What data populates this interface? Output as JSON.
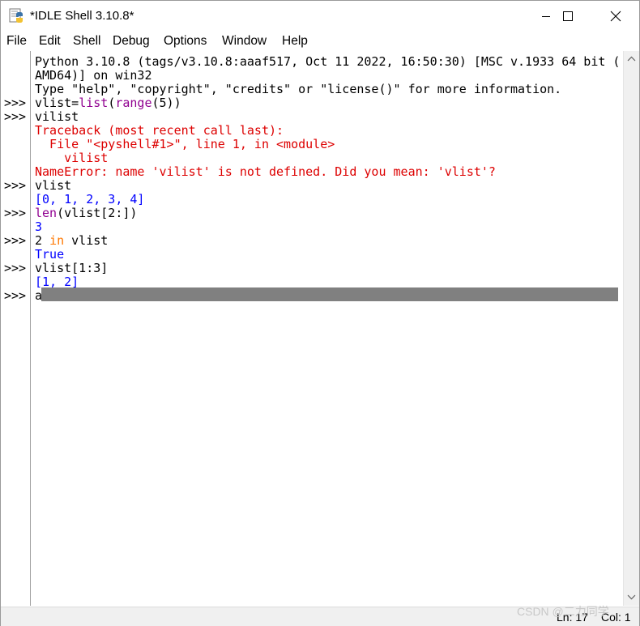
{
  "window": {
    "title": "*IDLE Shell 3.10.8*",
    "app_icon": "python-idle-icon",
    "controls": [
      "minimize-icon",
      "maximize-icon",
      "close-icon"
    ]
  },
  "menu": {
    "items": [
      "File",
      "Edit",
      "Shell",
      "Debug",
      "Options",
      "Window",
      "Help"
    ]
  },
  "shell": {
    "prompt": ">>>",
    "banner": [
      "Python 3.10.8 (tags/v3.10.8:aaaf517, Oct 11 2022, 16:50:30) [MSC v.1933 64 bit (",
      "AMD64)] on win32",
      "Type \"help\", \"copyright\", \"credits\" or \"license()\" for more information."
    ],
    "cmd1": {
      "a": "vlist=",
      "b": "list",
      "c": "(",
      "d": "range",
      "e": "(5))"
    },
    "cmd2": "vilist",
    "traceback": [
      "Traceback (most recent call last):",
      "  File \"<pyshell#1>\", line 1, in <module>",
      "    vilist",
      "NameError: name 'vilist' is not defined. Did you mean: 'vlist'?"
    ],
    "cmd3": "vlist",
    "out3": "[0, 1, 2, 3, 4]",
    "cmd4": {
      "a": "len",
      "b": "(vlist[2:])"
    },
    "out4": "3",
    "cmd5": {
      "a": "2 ",
      "b": "in",
      "c": " vlist"
    },
    "out5": "True",
    "cmd6": "vlist[1:3]",
    "out6": "[1, 2]",
    "cmd7": "a"
  },
  "status": {
    "line": "Ln: 17",
    "col": "Col: 1"
  },
  "watermark": "CSDN @二力同学",
  "colors": {
    "builtin": "#900090",
    "keyword": "#ff7700",
    "output": "#0000ff",
    "error": "#dd0000",
    "selection": "#808080"
  }
}
